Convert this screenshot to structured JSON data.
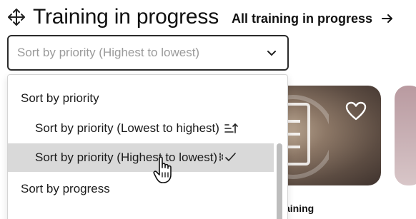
{
  "header": {
    "title": "Training in progress",
    "all_link": "All training in progress",
    "move_icon": "move-arrows-icon",
    "arrow_icon": "arrow-right-icon"
  },
  "sort_select": {
    "value": "Sort by priority (Highest to lowest)",
    "chevron_icon": "chevron-down-icon"
  },
  "menu": {
    "groups": [
      {
        "label": "Sort by priority",
        "options": [
          {
            "label": "Sort by priority (Lowest to highest)",
            "icon": "sort-ascending-icon",
            "selected": false
          },
          {
            "label": "Sort by priority (Highest to lowest)",
            "icon": "sort-descending-check-icon",
            "selected": true
          }
        ]
      },
      {
        "label": "Sort by progress",
        "options": []
      }
    ]
  },
  "card": {
    "caption_partial": "aining",
    "heart_icon": "heart-outline-icon",
    "image": "document-illustration"
  },
  "colors": {
    "selected_bg": "#d9d9d9",
    "placeholder": "#9a9a9a",
    "text": "#1b1b1b"
  }
}
